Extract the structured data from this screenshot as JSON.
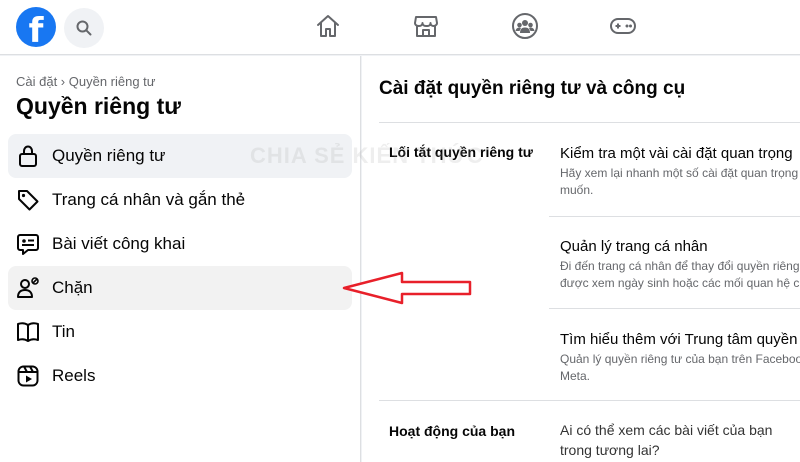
{
  "colors": {
    "brand": "#1877f2",
    "arrow": "#e8202a",
    "secondary_text": "#65676b"
  },
  "header": {
    "logo_letter": "f",
    "icons": [
      "facebook-logo",
      "search-icon",
      "home-icon",
      "marketplace-icon",
      "groups-icon",
      "gaming-icon"
    ]
  },
  "sidebar": {
    "breadcrumb": "Cài đặt › Quyền riêng tư",
    "title": "Quyền riêng tư",
    "items": [
      {
        "label": "Quyền riêng tư",
        "icon": "lock-icon"
      },
      {
        "label": "Trang cá nhân và gắn thẻ",
        "icon": "tag-icon"
      },
      {
        "label": "Bài viết công khai",
        "icon": "public-post-icon"
      },
      {
        "label": "Chặn",
        "icon": "block-user-icon"
      },
      {
        "label": "Tin",
        "icon": "story-book-icon"
      },
      {
        "label": "Reels",
        "icon": "reels-icon"
      }
    ]
  },
  "main": {
    "title": "Cài đặt quyền riêng tư và công cụ",
    "sections": [
      {
        "label": "Lối tắt quyền riêng tư",
        "rows": [
          {
            "title": "Kiểm tra một vài cài đặt quan trọng",
            "desc1": "Hãy xem lại nhanh một số cài đặt quan trọng",
            "desc2": "muốn."
          },
          {
            "title": "Quản lý trang cá nhân",
            "desc1": "Đi đến trang cá nhân để thay đổi quyền riêng",
            "desc2": "được xem ngày sinh hoặc các mối quan hệ c"
          },
          {
            "title": "Tìm hiểu thêm với Trung tâm quyền",
            "desc1": "Quản lý quyền riêng tư của bạn trên Faceboo",
            "desc2": "Meta."
          }
        ]
      },
      {
        "label": "Hoạt động của bạn",
        "rows": [
          {
            "title": "Ai có thể xem các bài viết của bạn",
            "title2": "trong tương lai?"
          }
        ]
      }
    ]
  },
  "watermark": "CHIA SẺ KIẾN THỨC"
}
